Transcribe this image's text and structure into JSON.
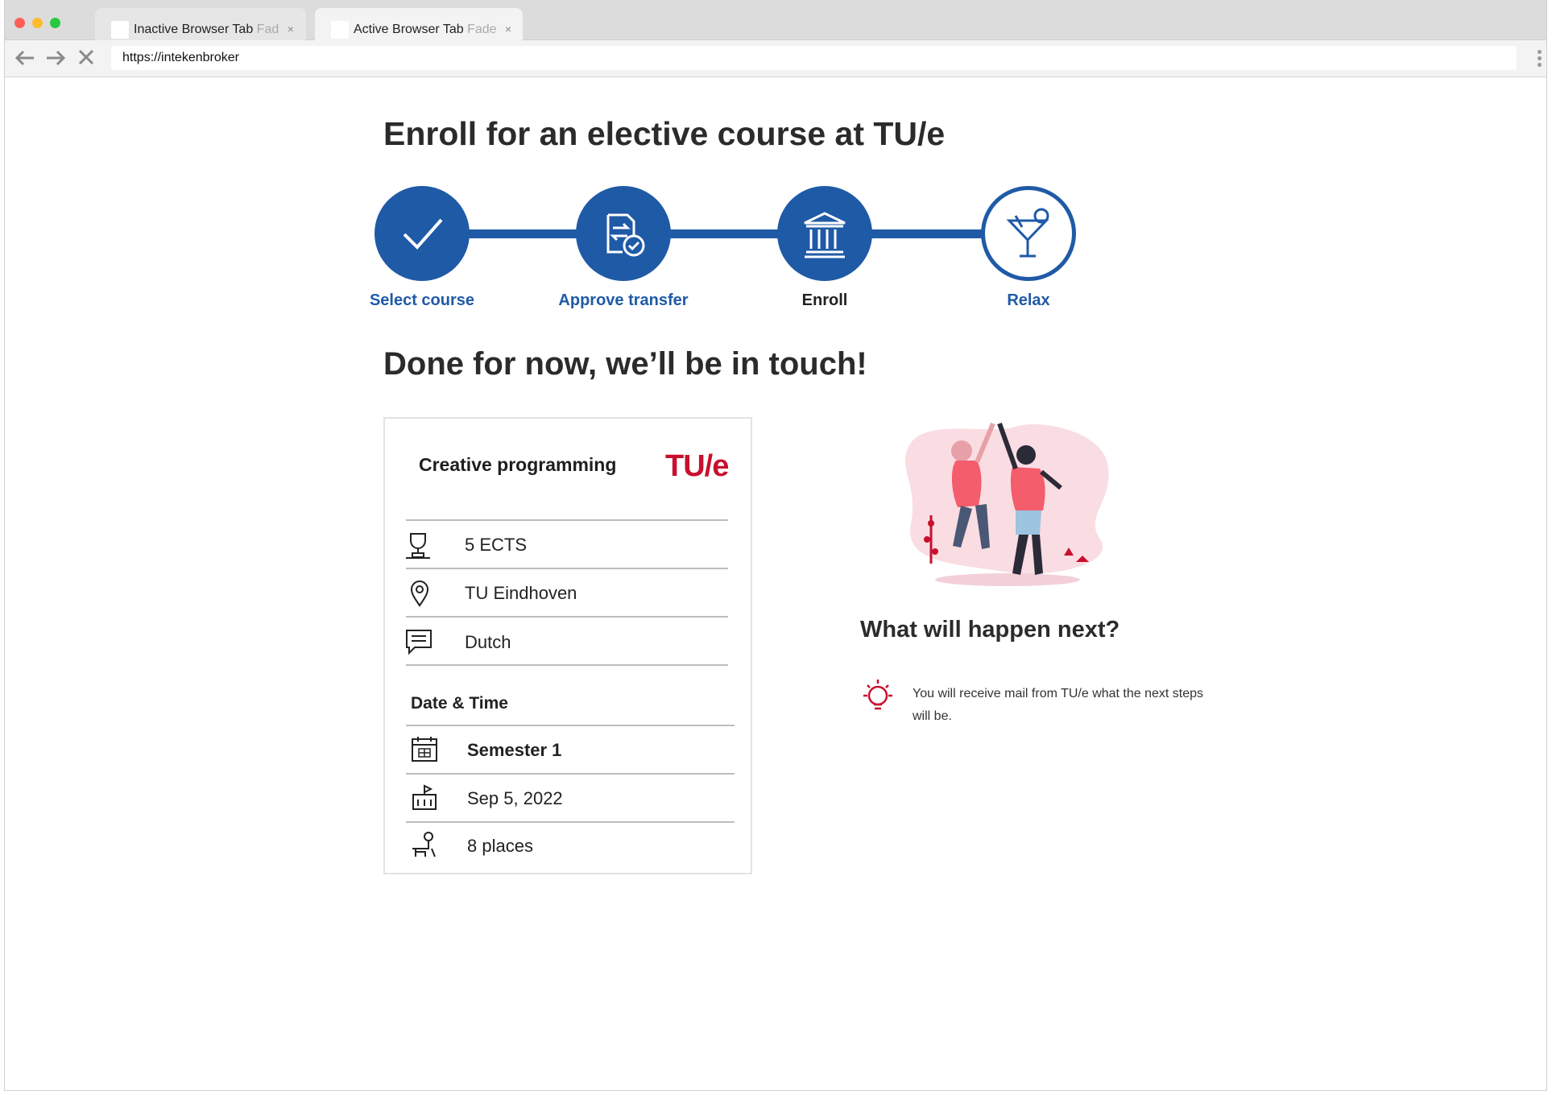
{
  "browser": {
    "tabs": [
      {
        "label": "Inactive Browser Tab",
        "fade": "Fad",
        "active": false
      },
      {
        "label": "Active Browser Tab",
        "fade": "Fade",
        "active": true
      }
    ],
    "close_glyph": "×",
    "url": "https://intekenbroker",
    "nav_icons": [
      "back-arrow-icon",
      "forward-arrow-icon",
      "stop-icon"
    ],
    "traffic_light_colors": [
      "#ff5f57",
      "#febc2e",
      "#28c840"
    ]
  },
  "page": {
    "title": "Enroll for an elective course at TU/e",
    "steps": [
      {
        "label": "Select course",
        "icon": "checkmark-icon",
        "state": "done",
        "label_color": "#1f5aa6"
      },
      {
        "label": "Approve transfer",
        "icon": "document-transfer-check-icon",
        "state": "done",
        "label_color": "#1f5aa6"
      },
      {
        "label": "Enroll",
        "icon": "university-building-icon",
        "state": "done",
        "label_color": "#222222"
      },
      {
        "label": "Relax",
        "icon": "cocktail-glass-icon",
        "state": "current",
        "label_color": "#1f5aa6"
      }
    ],
    "done_heading": "Done for now, we’ll be in touch!"
  },
  "course_card": {
    "title": "Creative programming",
    "logo_text": "TU/e",
    "details": [
      {
        "icon": "trophy-icon",
        "text": "5 ECTS"
      },
      {
        "icon": "location-pin-icon",
        "text": "TU Eindhoven"
      },
      {
        "icon": "chat-bubble-icon",
        "text": "Dutch"
      }
    ],
    "date_time_heading": "Date & Time",
    "schedule": [
      {
        "icon": "calendar-icon",
        "text": "Semester 1",
        "bold": true
      },
      {
        "icon": "start-date-icon",
        "text": "Sep 5, 2022",
        "bold": false
      },
      {
        "icon": "seats-icon",
        "text": "8 places",
        "bold": false
      }
    ]
  },
  "next": {
    "illustration": "celebrating-people-illustration",
    "heading": "What will happen next?",
    "icon": "lightbulb-icon",
    "message": "You will receive mail from TU/e what the next steps will be."
  },
  "colors": {
    "primary_blue": "#1f5aa6",
    "tue_red": "#c8102e"
  }
}
